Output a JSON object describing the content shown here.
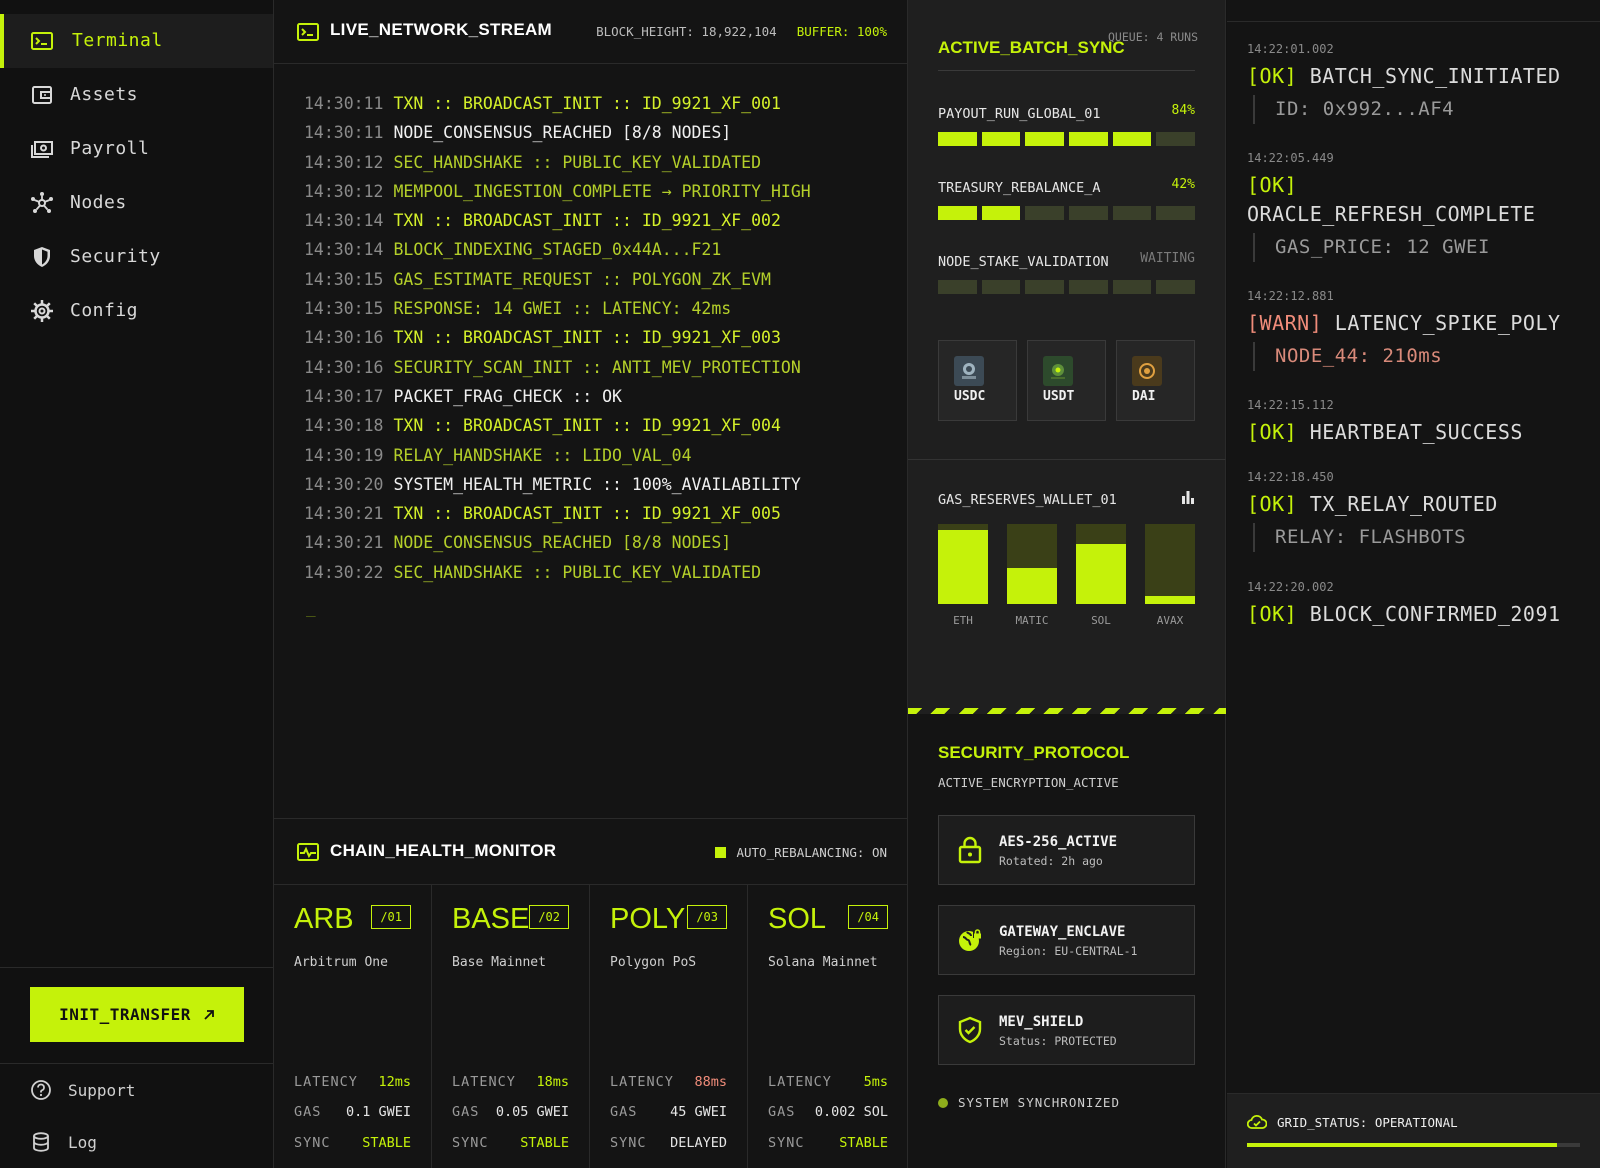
{
  "sidebar": {
    "items": [
      {
        "label": "Terminal",
        "icon": "terminal-icon",
        "active": true
      },
      {
        "label": "Assets",
        "icon": "wallet-icon",
        "active": false
      },
      {
        "label": "Payroll",
        "icon": "payments-icon",
        "active": false
      },
      {
        "label": "Nodes",
        "icon": "hub-icon",
        "active": false
      },
      {
        "label": "Security",
        "icon": "shield-icon",
        "active": false
      },
      {
        "label": "Config",
        "icon": "gear-icon",
        "active": false
      }
    ],
    "cta_label": "INIT_TRANSFER",
    "cta_icon": "arrow-up-right-icon",
    "footer": [
      {
        "label": "Support",
        "icon": "help-icon"
      },
      {
        "label": "Log",
        "icon": "database-icon"
      }
    ]
  },
  "stream": {
    "title": "LIVE_NETWORK_STREAM",
    "block_height": "BLOCK_HEIGHT: 18,922,104",
    "buffer": "BUFFER: 100%",
    "cursor": "_",
    "lines": [
      {
        "ts": "14:30:11",
        "msg": "TXN :: BROADCAST_INIT :: ID_9921_XF_001",
        "kind": "txn"
      },
      {
        "ts": "14:30:11",
        "msg": "NODE_CONSENSUS_REACHED [8/8 NODES]",
        "kind": "white"
      },
      {
        "ts": "14:30:12",
        "msg": "SEC_HANDSHAKE :: PUBLIC_KEY_VALIDATED",
        "kind": "olive"
      },
      {
        "ts": "14:30:12",
        "msg": "MEMPOOL_INGESTION_COMPLETE → PRIORITY_HIGH",
        "kind": "olive"
      },
      {
        "ts": "14:30:14",
        "msg": "TXN :: BROADCAST_INIT :: ID_9921_XF_002",
        "kind": "txn"
      },
      {
        "ts": "14:30:14",
        "msg": "BLOCK_INDEXING_STAGED_0x44A...F21",
        "kind": "olive"
      },
      {
        "ts": "14:30:15",
        "msg": "GAS_ESTIMATE_REQUEST :: POLYGON_ZK_EVM",
        "kind": "olive"
      },
      {
        "ts": "14:30:15",
        "msg": "RESPONSE: 14 GWEI :: LATENCY: 42ms",
        "kind": "olive"
      },
      {
        "ts": "14:30:16",
        "msg": "TXN :: BROADCAST_INIT :: ID_9921_XF_003",
        "kind": "txn"
      },
      {
        "ts": "14:30:16",
        "msg": "SECURITY_SCAN_INIT :: ANTI_MEV_PROTECTION",
        "kind": "olive"
      },
      {
        "ts": "14:30:17",
        "msg": "PACKET_FRAG_CHECK :: OK",
        "kind": "white"
      },
      {
        "ts": "14:30:18",
        "msg": "TXN :: BROADCAST_INIT :: ID_9921_XF_004",
        "kind": "txn"
      },
      {
        "ts": "14:30:19",
        "msg": "RELAY_HANDSHAKE :: LIDO_VAL_04",
        "kind": "olive"
      },
      {
        "ts": "14:30:20",
        "msg": "SYSTEM_HEALTH_METRIC :: 100%_AVAILABILITY",
        "kind": "white"
      },
      {
        "ts": "14:30:21",
        "msg": "TXN :: BROADCAST_INIT :: ID_9921_XF_005",
        "kind": "txn"
      },
      {
        "ts": "14:30:21",
        "msg": "NODE_CONSENSUS_REACHED [8/8 NODES]",
        "kind": "olive"
      },
      {
        "ts": "14:30:22",
        "msg": "SEC_HANDSHAKE :: PUBLIC_KEY_VALIDATED",
        "kind": "olive"
      }
    ]
  },
  "health": {
    "title": "CHAIN_HEALTH_MONITOR",
    "auto_rebalancing": "AUTO_REBALANCING: ON",
    "chains": [
      {
        "symbol": "ARB",
        "index": "/01",
        "name": "Arbitrum One",
        "latency": "12ms",
        "gas": "0.1 GWEI",
        "sync": "STABLE",
        "latency_state": "ok",
        "sync_state": "ok"
      },
      {
        "symbol": "BASE",
        "index": "/02",
        "name": "Base Mainnet",
        "latency": "18ms",
        "gas": "0.05 GWEI",
        "sync": "STABLE",
        "latency_state": "ok",
        "sync_state": "ok"
      },
      {
        "symbol": "POLY",
        "index": "/03",
        "name": "Polygon PoS",
        "latency": "88ms",
        "gas": "45 GWEI",
        "sync": "DELAYED",
        "latency_state": "warn",
        "sync_state": "neutral"
      },
      {
        "symbol": "SOL",
        "index": "/04",
        "name": "Solana Mainnet",
        "latency": "5ms",
        "gas": "0.002 SOL",
        "sync": "STABLE",
        "latency_state": "ok",
        "sync_state": "ok"
      }
    ],
    "labels": {
      "latency": "LATENCY",
      "gas": "GAS",
      "sync": "SYNC"
    }
  },
  "batch": {
    "title": "ACTIVE_BATCH_SYNC",
    "queue": "QUEUE: 4 RUNS",
    "runs": [
      {
        "name": "PAYOUT_RUN_GLOBAL_01",
        "status": "84%",
        "segments_on": 5,
        "segments_total": 6,
        "waiting": false
      },
      {
        "name": "TREASURY_REBALANCE_A",
        "status": "42%",
        "segments_on": 2,
        "segments_total": 6,
        "waiting": false
      },
      {
        "name": "NODE_STAKE_VALIDATION",
        "status": "WAITING",
        "segments_on": 0,
        "segments_total": 6,
        "waiting": true
      }
    ],
    "coins": [
      {
        "label": "USDC",
        "icon": "usdc-coin-icon"
      },
      {
        "label": "USDT",
        "icon": "usdt-coin-icon"
      },
      {
        "label": "DAI",
        "icon": "dai-coin-icon"
      }
    ]
  },
  "gas": {
    "title": "GAS_RESERVES_WALLET_01",
    "icon": "bar-chart-icon",
    "chart_data": {
      "type": "bar",
      "categories": [
        "ETH",
        "MATIC",
        "SOL",
        "AVAX"
      ],
      "values": [
        0.92,
        0.45,
        0.75,
        0.1
      ],
      "ylim": [
        0,
        1
      ]
    }
  },
  "security": {
    "title": "SECURITY_PROTOCOL",
    "subtitle": "ACTIVE_ENCRYPTION_ACTIVE",
    "cards": [
      {
        "name": "AES-256_ACTIVE",
        "detail": "Rotated: 2h ago",
        "icon": "lock-icon"
      },
      {
        "name": "GATEWAY_ENCLAVE",
        "detail": "Region: EU-CENTRAL-1",
        "icon": "globe-lock-icon"
      },
      {
        "name": "MEV_SHIELD",
        "detail": "Status: PROTECTED",
        "icon": "shield-check-icon"
      }
    ],
    "sync_status": "SYSTEM SYNCHRONIZED"
  },
  "events": {
    "items": [
      {
        "ts": "14:22:01.002",
        "tag": "[OK]",
        "msg": "BATCH_SYNC_INITIATED",
        "detail": "ID: 0x992...AF4",
        "level": "ok"
      },
      {
        "ts": "14:22:05.449",
        "tag": "[OK]",
        "msg": "ORACLE_REFRESH_COMPLETE",
        "detail": "GAS_PRICE: 12 GWEI",
        "level": "ok"
      },
      {
        "ts": "14:22:12.881",
        "tag": "[WARN]",
        "msg": "LATENCY_SPIKE_POLY",
        "detail": "NODE_44: 210ms",
        "level": "warn"
      },
      {
        "ts": "14:22:15.112",
        "tag": "[OK]",
        "msg": "HEARTBEAT_SUCCESS",
        "detail": "",
        "level": "ok"
      },
      {
        "ts": "14:22:18.450",
        "tag": "[OK]",
        "msg": "TX_RELAY_ROUTED",
        "detail": "RELAY: FLASHBOTS",
        "level": "ok"
      },
      {
        "ts": "14:22:20.002",
        "tag": "[OK]",
        "msg": "BLOCK_CONFIRMED_2091",
        "detail": "",
        "level": "ok"
      }
    ],
    "grid_status": "GRID_STATUS: OPERATIONAL",
    "grid_progress": 0.93
  },
  "colors": {
    "accent": "#c5f20a",
    "warn": "#f08c7a",
    "bg": "#121212"
  }
}
